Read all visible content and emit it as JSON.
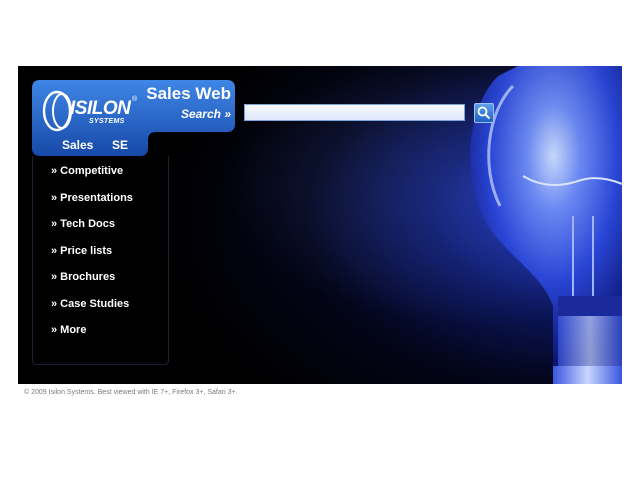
{
  "brand": {
    "logo_word": "ISILON",
    "logo_sub": "SYSTEMS",
    "logo_mark": "®",
    "site_title": "Sales Web",
    "search_label": "Search »"
  },
  "tabs": [
    {
      "label": "Sales"
    },
    {
      "label": "SE"
    }
  ],
  "nav": {
    "items": [
      {
        "label": "» Competitive"
      },
      {
        "label": "» Presentations"
      },
      {
        "label": "» Tech Docs"
      },
      {
        "label": "» Price lists"
      },
      {
        "label": "» Brochures"
      },
      {
        "label": "» Case Studies"
      },
      {
        "label": "» More"
      }
    ]
  },
  "search": {
    "value": "",
    "button_icon": "magnifier-icon"
  },
  "footer": {
    "text": "© 2009 Isilon Systems. Best viewed with IE 7+, Firefox 3+, Safari 3+."
  },
  "colors": {
    "brand_blue": "#1f63c9",
    "background": "#000000",
    "glow_blue": "#2846e6"
  }
}
